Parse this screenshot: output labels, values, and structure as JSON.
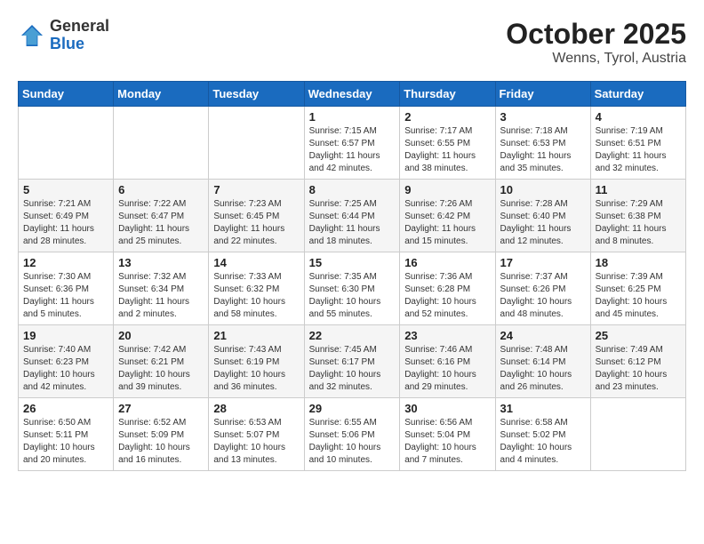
{
  "logo": {
    "general": "General",
    "blue": "Blue"
  },
  "title": "October 2025",
  "subtitle": "Wenns, Tyrol, Austria",
  "days_of_week": [
    "Sunday",
    "Monday",
    "Tuesday",
    "Wednesday",
    "Thursday",
    "Friday",
    "Saturday"
  ],
  "weeks": [
    [
      {
        "day": "",
        "info": ""
      },
      {
        "day": "",
        "info": ""
      },
      {
        "day": "",
        "info": ""
      },
      {
        "day": "1",
        "info": "Sunrise: 7:15 AM\nSunset: 6:57 PM\nDaylight: 11 hours and 42 minutes."
      },
      {
        "day": "2",
        "info": "Sunrise: 7:17 AM\nSunset: 6:55 PM\nDaylight: 11 hours and 38 minutes."
      },
      {
        "day": "3",
        "info": "Sunrise: 7:18 AM\nSunset: 6:53 PM\nDaylight: 11 hours and 35 minutes."
      },
      {
        "day": "4",
        "info": "Sunrise: 7:19 AM\nSunset: 6:51 PM\nDaylight: 11 hours and 32 minutes."
      }
    ],
    [
      {
        "day": "5",
        "info": "Sunrise: 7:21 AM\nSunset: 6:49 PM\nDaylight: 11 hours and 28 minutes."
      },
      {
        "day": "6",
        "info": "Sunrise: 7:22 AM\nSunset: 6:47 PM\nDaylight: 11 hours and 25 minutes."
      },
      {
        "day": "7",
        "info": "Sunrise: 7:23 AM\nSunset: 6:45 PM\nDaylight: 11 hours and 22 minutes."
      },
      {
        "day": "8",
        "info": "Sunrise: 7:25 AM\nSunset: 6:44 PM\nDaylight: 11 hours and 18 minutes."
      },
      {
        "day": "9",
        "info": "Sunrise: 7:26 AM\nSunset: 6:42 PM\nDaylight: 11 hours and 15 minutes."
      },
      {
        "day": "10",
        "info": "Sunrise: 7:28 AM\nSunset: 6:40 PM\nDaylight: 11 hours and 12 minutes."
      },
      {
        "day": "11",
        "info": "Sunrise: 7:29 AM\nSunset: 6:38 PM\nDaylight: 11 hours and 8 minutes."
      }
    ],
    [
      {
        "day": "12",
        "info": "Sunrise: 7:30 AM\nSunset: 6:36 PM\nDaylight: 11 hours and 5 minutes."
      },
      {
        "day": "13",
        "info": "Sunrise: 7:32 AM\nSunset: 6:34 PM\nDaylight: 11 hours and 2 minutes."
      },
      {
        "day": "14",
        "info": "Sunrise: 7:33 AM\nSunset: 6:32 PM\nDaylight: 10 hours and 58 minutes."
      },
      {
        "day": "15",
        "info": "Sunrise: 7:35 AM\nSunset: 6:30 PM\nDaylight: 10 hours and 55 minutes."
      },
      {
        "day": "16",
        "info": "Sunrise: 7:36 AM\nSunset: 6:28 PM\nDaylight: 10 hours and 52 minutes."
      },
      {
        "day": "17",
        "info": "Sunrise: 7:37 AM\nSunset: 6:26 PM\nDaylight: 10 hours and 48 minutes."
      },
      {
        "day": "18",
        "info": "Sunrise: 7:39 AM\nSunset: 6:25 PM\nDaylight: 10 hours and 45 minutes."
      }
    ],
    [
      {
        "day": "19",
        "info": "Sunrise: 7:40 AM\nSunset: 6:23 PM\nDaylight: 10 hours and 42 minutes."
      },
      {
        "day": "20",
        "info": "Sunrise: 7:42 AM\nSunset: 6:21 PM\nDaylight: 10 hours and 39 minutes."
      },
      {
        "day": "21",
        "info": "Sunrise: 7:43 AM\nSunset: 6:19 PM\nDaylight: 10 hours and 36 minutes."
      },
      {
        "day": "22",
        "info": "Sunrise: 7:45 AM\nSunset: 6:17 PM\nDaylight: 10 hours and 32 minutes."
      },
      {
        "day": "23",
        "info": "Sunrise: 7:46 AM\nSunset: 6:16 PM\nDaylight: 10 hours and 29 minutes."
      },
      {
        "day": "24",
        "info": "Sunrise: 7:48 AM\nSunset: 6:14 PM\nDaylight: 10 hours and 26 minutes."
      },
      {
        "day": "25",
        "info": "Sunrise: 7:49 AM\nSunset: 6:12 PM\nDaylight: 10 hours and 23 minutes."
      }
    ],
    [
      {
        "day": "26",
        "info": "Sunrise: 6:50 AM\nSunset: 5:11 PM\nDaylight: 10 hours and 20 minutes."
      },
      {
        "day": "27",
        "info": "Sunrise: 6:52 AM\nSunset: 5:09 PM\nDaylight: 10 hours and 16 minutes."
      },
      {
        "day": "28",
        "info": "Sunrise: 6:53 AM\nSunset: 5:07 PM\nDaylight: 10 hours and 13 minutes."
      },
      {
        "day": "29",
        "info": "Sunrise: 6:55 AM\nSunset: 5:06 PM\nDaylight: 10 hours and 10 minutes."
      },
      {
        "day": "30",
        "info": "Sunrise: 6:56 AM\nSunset: 5:04 PM\nDaylight: 10 hours and 7 minutes."
      },
      {
        "day": "31",
        "info": "Sunrise: 6:58 AM\nSunset: 5:02 PM\nDaylight: 10 hours and 4 minutes."
      },
      {
        "day": "",
        "info": ""
      }
    ]
  ]
}
